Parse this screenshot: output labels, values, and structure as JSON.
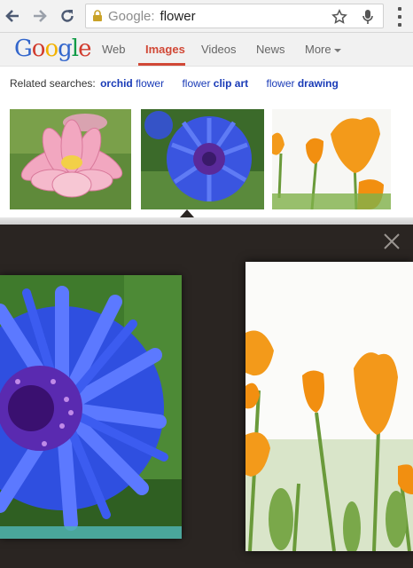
{
  "browser": {
    "omnibox_host": "Google:",
    "omnibox_query": "flower",
    "icons": [
      "back-arrow-icon",
      "forward-arrow-icon",
      "reload-icon",
      "lock-icon",
      "star-icon",
      "mic-icon",
      "overflow-menu-icon"
    ]
  },
  "google_nav": {
    "logo": [
      "G",
      "o",
      "o",
      "g",
      "l",
      "e"
    ],
    "tabs": [
      {
        "label": "Web",
        "active": false
      },
      {
        "label": "Images",
        "active": true
      },
      {
        "label": "Videos",
        "active": false
      },
      {
        "label": "News",
        "active": false
      },
      {
        "label": "More",
        "active": false
      }
    ]
  },
  "related": {
    "prefix": "Related searches:",
    "items": [
      {
        "bold": "orchid",
        "rest": " flower"
      },
      {
        "rest": "flower ",
        "bold": "clip art"
      },
      {
        "rest": "flower ",
        "bold": "drawing"
      }
    ]
  },
  "thumbnails": [
    {
      "subject": "pink lotus flower"
    },
    {
      "subject": "blue cornflower",
      "selected": true
    },
    {
      "subject": "orange poppies"
    }
  ],
  "lightbox": {
    "close_icon": "close-icon",
    "previews": [
      {
        "subject": "blue cornflower close-up"
      },
      {
        "subject": "orange poppies on white"
      }
    ]
  },
  "colors": {
    "accent": "#d14836",
    "link": "#1a3bb7",
    "lightbox_bg": "#2a2522"
  }
}
